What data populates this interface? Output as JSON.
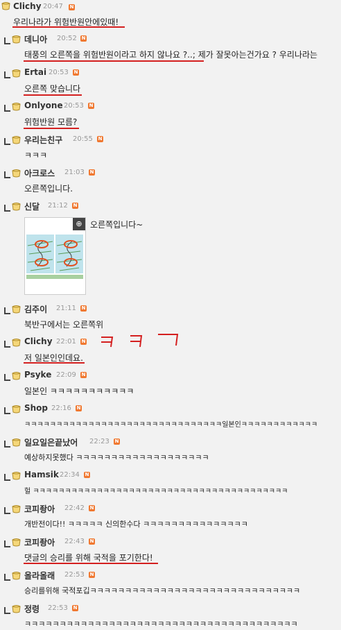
{
  "comments": [
    {
      "nick": "Clichy",
      "time": "20:47",
      "badge": "N",
      "text": "우리나라가 위험반원안에있때!"
    },
    {
      "nick": "데니아",
      "time": "20:52",
      "badge": "N",
      "text": "태풍의 오른쪽을 위험반원이라고 하지 않나요 ?..; 제가 잘못아는건가요 ? 우리나라는"
    },
    {
      "nick": "Ertai",
      "time": "20:53",
      "badge": "N",
      "text": "오른쪽 맞습니다"
    },
    {
      "nick": "Onlyone",
      "time": "20:53",
      "badge": "N",
      "text": "위험반원 모름?"
    },
    {
      "nick": "우리는친구",
      "time": "20:55",
      "badge": "N",
      "text": "ㅋㅋㅋ"
    },
    {
      "nick": "아크로스",
      "time": "21:03",
      "badge": "N",
      "text": "오른쪽입니다."
    },
    {
      "nick": "신달",
      "time": "21:12",
      "badge": "N",
      "text": "오른쪽입니다~"
    },
    {
      "nick": "김주이",
      "time": "21:11",
      "badge": "N",
      "text": "북반구에서는 오른쪽위"
    },
    {
      "nick": "Clichy",
      "time": "22:01",
      "badge": "N",
      "text": "저 일본인인데요."
    },
    {
      "nick": "Psyke",
      "time": "22:09",
      "badge": "N",
      "text": "일본인 ㅋㅋㅋㅋㅋㅋㅋㅋㅋㅋㅋ"
    },
    {
      "nick": "Shop",
      "time": "22:16",
      "badge": "N",
      "text": "ㅋㅋㅋㅋㅋㅋㅋㅋㅋㅋㅋㅋㅋㅋㅋㅋㅋㅋㅋㅋㅋㅋㅋㅋㅋㅋㅋㅋㅋㅋㅋ일본인ㅋㅋㅋㅋㅋㅋㅋㅋㅋㅋㅋㅋ"
    },
    {
      "nick": "일요일은끝났어",
      "time": "22:23",
      "badge": "N",
      "text": "예상하지못했다 ㅋㅋㅋㅋㅋㅋㅋㅋㅋㅋㅋㅋㅋㅋㅋㅋㅋㅋㅋ"
    },
    {
      "nick": "Hamsik",
      "time": "22:34",
      "badge": "N",
      "text": "헐 ㅋㅋㅋㅋㅋㅋㅋㅋㅋㅋㅋㅋㅋㅋㅋㅋㅋㅋㅋㅋㅋㅋㅋㅋㅋㅋㅋㅋㅋㅋㅋㅋㅋㅋㅋㅋㅋㅋㅋㅋ"
    },
    {
      "nick": "코피좡아",
      "time": "22:42",
      "badge": "N",
      "text": "개반전이다!! ㅋㅋㅋㅋㅋ 신의한수다 ㅋㅋㅋㅋㅋㅋㅋㅋㅋㅋㅋㅋㅋㅋㅋ"
    },
    {
      "nick": "코피좡아",
      "time": "22:43",
      "badge": "N",
      "text": "댓글의 승리를 위해 국적을 포기한다!"
    },
    {
      "nick": "올라올래",
      "time": "22:53",
      "badge": "N",
      "text": "승리를위해 국적포깁ㅋㅋㅋㅋㅋㅋㅋㅋㅋㅋㅋㅋㅋㅋㅋㅋㅋㅋㅋㅋㅋㅋㅋㅋㅋㅋㅋㅋㅋㅋ"
    },
    {
      "nick": "정령",
      "time": "22:53",
      "badge": "N",
      "text": "ㅋㅋㅋㅋㅋㅋㅋㅋㅋㅋㅋㅋㅋㅋㅋㅋㅋㅋㅋㅋㅋㅋㅋㅋㅋㅋㅋㅋㅋㅋㅋㅋㅋㅋㅋㅋㅋㅋㅋ"
    }
  ],
  "attachment": {
    "zoom_icon": "magnifier-plus-icon",
    "zoom_glyph": "⊕"
  },
  "annotations": {
    "scribble_text": "ㅋ ㅋ ㅋ",
    "color": "#d42020"
  }
}
